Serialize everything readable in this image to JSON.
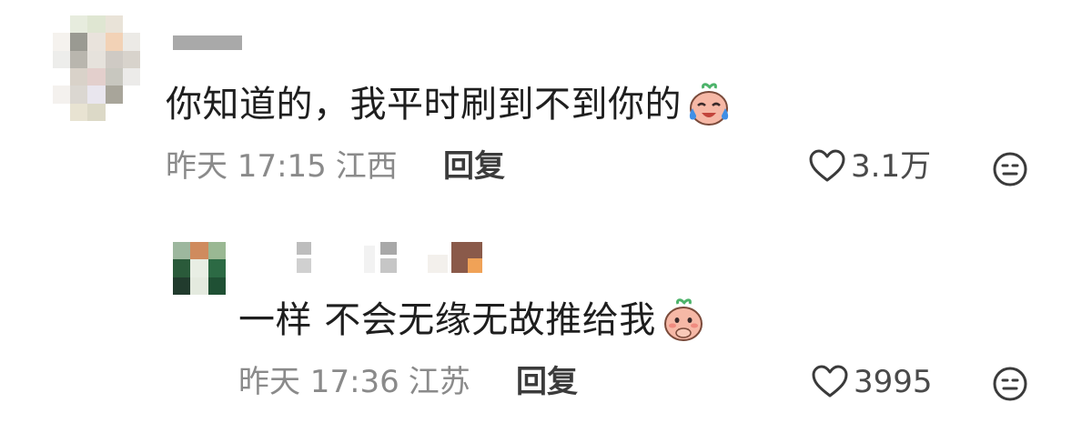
{
  "comment": {
    "text": "你知道的，我平时刷到不到你的",
    "emoji": "crying-face-emoji",
    "time": "昨天 17:15",
    "location": "江西",
    "reply_label": "回复",
    "likes": "3.1万"
  },
  "reply": {
    "text": "一样 不会无缘无故推给我",
    "emoji": "shy-face-emoji",
    "time": "昨天 17:36",
    "location": "江苏",
    "reply_label": "回复",
    "likes": "3995"
  },
  "colors": {
    "meta_text": "#8a8a8a",
    "main_text": "#1e1e1e",
    "emoji_face": "#f6b8a6",
    "emoji_leaf": "#4cb36a"
  }
}
